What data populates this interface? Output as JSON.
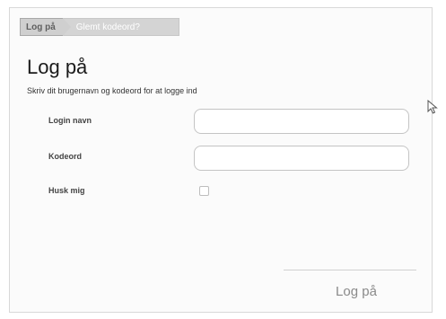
{
  "tabs": {
    "login_label": "Log på",
    "forgot_label": "Glemt kodeord?"
  },
  "main": {
    "title": "Log på",
    "subtitle": "Skriv dit brugernavn og kodeord for at logge ind"
  },
  "form": {
    "username_label": "Login navn",
    "username_value": "",
    "password_label": "Kodeord",
    "password_value": "",
    "remember_label": "Husk mig",
    "remember_checked": false,
    "submit_label": "Log på"
  },
  "colors": {
    "title_text": "#1b1b1b",
    "tab_active_bg": "#cfcfcf",
    "submit_text": "#8a8a8a"
  },
  "icons": {
    "cursor": "mouse-pointer-icon"
  }
}
